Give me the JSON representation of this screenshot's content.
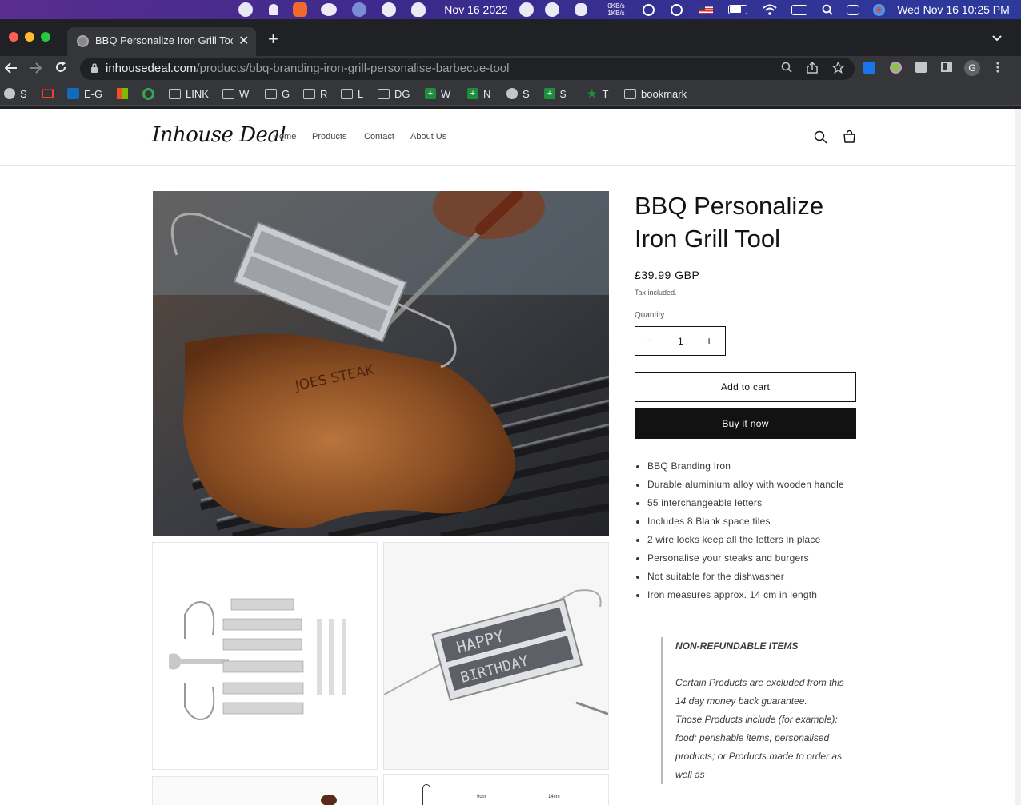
{
  "menubar": {
    "date_text": "Nov 16 2022",
    "net_up": "0KB/s",
    "net_down": "1KB/s",
    "clock": "Wed Nov 16  10:25 PM",
    "icons": [
      "line-icon",
      "notification-icon",
      "app-icon",
      "wechat-icon",
      "shortcut-icon",
      "messenger-icon",
      "cat-icon",
      "calendar-check-icon",
      "play-icon",
      "cat2-icon",
      "play-circle-icon",
      "history-icon",
      "us-flag-icon",
      "battery-icon",
      "wifi-icon",
      "keyboard-icon",
      "search-icon",
      "control-center-icon",
      "siri-icon"
    ]
  },
  "browser": {
    "tab_title": "BBQ Personalize Iron Grill Tool",
    "tab_close": "✕",
    "new_tab": "+",
    "url_host": "inhousedeal.com",
    "url_path": "/products/bbq-branding-iron-grill-personalise-barbecue-tool",
    "profile_initial": "G",
    "bookmarks": [
      {
        "icon": "globe",
        "label": "S"
      },
      {
        "icon": "gmail",
        "label": ""
      },
      {
        "icon": "outlook",
        "label": "E-G"
      },
      {
        "icon": "microsoft",
        "label": ""
      },
      {
        "icon": "g-green",
        "label": ""
      },
      {
        "icon": "folder",
        "label": "LINK"
      },
      {
        "icon": "folder",
        "label": "W"
      },
      {
        "icon": "folder",
        "label": "G"
      },
      {
        "icon": "folder",
        "label": "R"
      },
      {
        "icon": "folder",
        "label": "L"
      },
      {
        "icon": "folder",
        "label": "DG"
      },
      {
        "icon": "green",
        "label": "W"
      },
      {
        "icon": "green",
        "label": "N"
      },
      {
        "icon": "globe",
        "label": "S"
      },
      {
        "icon": "green",
        "label": "$"
      },
      {
        "icon": "star",
        "label": "T"
      },
      {
        "icon": "folder",
        "label": "bookmark"
      }
    ]
  },
  "site": {
    "logo": "Inhouse Deal",
    "nav": [
      "Home",
      "Products",
      "Contact",
      "About Us"
    ]
  },
  "product": {
    "title": "BBQ Personalize Iron Grill Tool",
    "price": "£39.99 GBP",
    "tax_note": "Tax included.",
    "quantity_label": "Quantity",
    "quantity_value": "1",
    "decrease": "−",
    "increase": "+",
    "add_to_cart": "Add to cart",
    "buy_now": "Buy it now",
    "features": [
      "BBQ Branding Iron",
      "Durable aluminium alloy with wooden handle",
      "55 interchangeable letters",
      "Includes 8 Blank space tiles",
      "2 wire locks keep all the letters in place",
      "Personalise your steaks and burgers",
      "Not suitable for the dishwasher",
      "Iron measures approx. 14 cm in length"
    ],
    "policy_heading": "NON-REFUNDABLE ITEMS",
    "policy_p1": "Certain Products are excluded from this 14 day money back guarantee.",
    "policy_p2": "Those Products include (for example): food; perishable items; personalised products; or Products made to order as well as",
    "main_image_text": "JOES STEAK",
    "thumb2_text_top": "HAPPY",
    "thumb2_text_bottom": "BIRTHDAY",
    "thumb4_label_a": "9cm",
    "thumb4_label_b": "14cm"
  },
  "colors": {
    "text": "#121212",
    "button_dark": "#121212",
    "menubar_gradient_start": "#5a2d91"
  }
}
